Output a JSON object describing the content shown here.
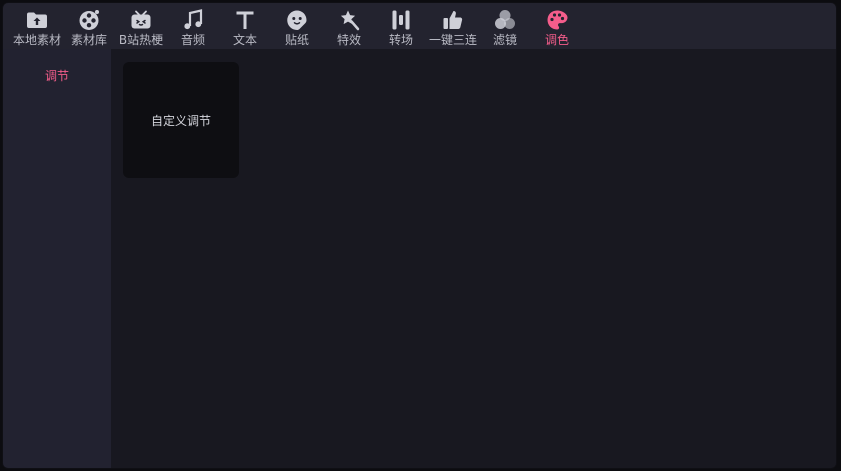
{
  "toolbar": {
    "items": [
      {
        "label": "本地素材",
        "icon": "folder-upload-icon"
      },
      {
        "label": "素材库",
        "icon": "film-reel-icon"
      },
      {
        "label": "B站热梗",
        "icon": "bilibili-tv-icon"
      },
      {
        "label": "音频",
        "icon": "music-note-icon"
      },
      {
        "label": "文本",
        "icon": "text-t-icon"
      },
      {
        "label": "贴纸",
        "icon": "sticker-face-icon"
      },
      {
        "label": "特效",
        "icon": "magic-wand-star-icon"
      },
      {
        "label": "转场",
        "icon": "transition-bars-icon"
      },
      {
        "label": "一键三连",
        "icon": "thumbs-up-icon"
      },
      {
        "label": "滤镜",
        "icon": "filter-circles-icon"
      },
      {
        "label": "调色",
        "icon": "palette-icon"
      }
    ],
    "active_index": 10
  },
  "sidebar": {
    "items": [
      {
        "label": "调节"
      }
    ]
  },
  "content": {
    "cards": [
      {
        "label": "自定义调节"
      }
    ]
  },
  "colors": {
    "accent": "#f45d8b",
    "icon": "#cfd0d8",
    "toolbar_bg": "#23232f",
    "panel_bg": "#181820",
    "sidebar_bg": "#222230"
  }
}
